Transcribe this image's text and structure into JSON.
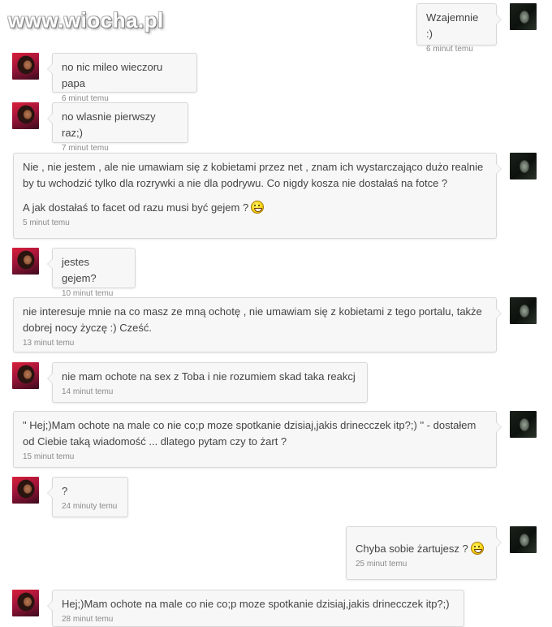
{
  "watermark": "www.wiocha.pl",
  "messages": [
    {
      "side": "right",
      "lines": [
        "Wzajemnie :)"
      ],
      "time": "6 minut temu"
    },
    {
      "side": "left",
      "lines": [
        "no nic mileo wieczoru papa"
      ],
      "time": "6 minut temu"
    },
    {
      "side": "left",
      "lines": [
        "no wlasnie pierwszy raz;)"
      ],
      "time": "7 minut temu"
    },
    {
      "side": "right",
      "lines": [
        "Nie , nie jestem , ale nie umawiam się z kobietami przez net , znam ich wystarczająco dużo realnie by tu wchodzić tylko dla rozrywki a nie dla podrywu. Co nigdy kosza nie dostałaś na fotce ?",
        "A jak dostałaś to facet od razu musi być gejem ?"
      ],
      "time": "5 minut temu",
      "emoji": "grin-smiley"
    },
    {
      "side": "left",
      "lines": [
        "jestes gejem?"
      ],
      "time": "10 minut temu"
    },
    {
      "side": "right",
      "lines": [
        "nie interesuje mnie na co masz ze mną ochotę , nie umawiam się z kobietami z tego portalu, także dobrej nocy życzę :) Cześć."
      ],
      "time": "13 minut temu"
    },
    {
      "side": "left",
      "lines": [
        "nie mam ochote na sex z Toba i nie rozumiem skad taka reakcj"
      ],
      "time": "14 minut temu"
    },
    {
      "side": "right",
      "lines": [
        "\" Hej;)Mam ochote na male co nie co;p moze spotkanie dzisiaj,jakis drinecczek itp?;) \" - dostałem od Ciebie taką wiadomość ... dlatego pytam czy to żart ?"
      ],
      "time": "15 minut temu"
    },
    {
      "side": "left",
      "lines": [
        "?"
      ],
      "time": "24 minuty temu"
    },
    {
      "side": "right",
      "lines": [
        "Chyba sobie żartujesz ?"
      ],
      "time": "25 minut temu",
      "emoji": "grin-smiley"
    },
    {
      "side": "left",
      "lines": [
        "Hej;)Mam ochote na male co nie co;p moze spotkanie dzisiaj,jakis drinecczek itp?;)"
      ],
      "time": "28 minut temu"
    }
  ]
}
